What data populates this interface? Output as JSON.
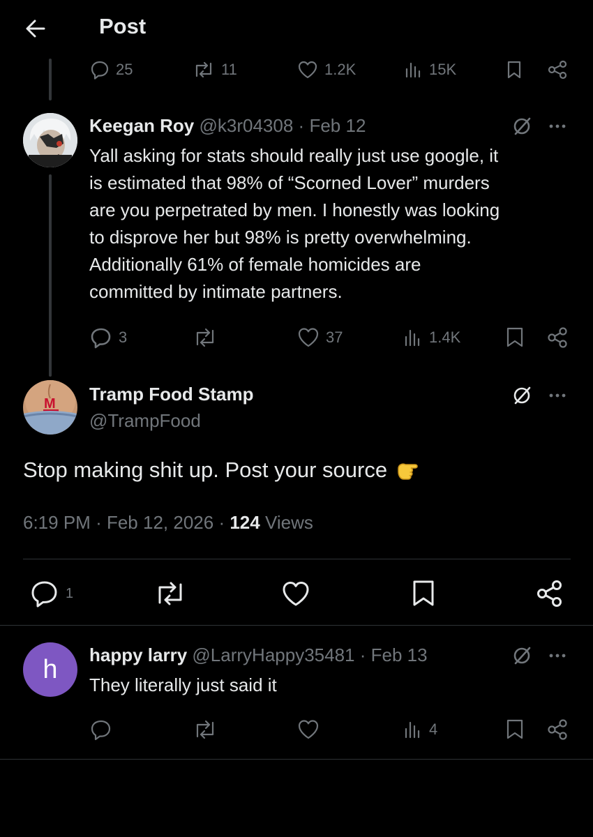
{
  "header": {
    "title": "Post"
  },
  "parent_actions": {
    "replies": "25",
    "reposts": "11",
    "likes": "1.2K",
    "views": "15K"
  },
  "tweet1": {
    "name": "Keegan Roy",
    "handle": "@k3r04308",
    "sep": "·",
    "date": "Feb 12",
    "text": "Yall asking for stats should really just use google, it\nis estimated that 98% of “Scorned Lover” murders\nare you perpetrated by men. I honestly was looking\nto disprove her but 98% is pretty overwhelming.\nAdditionally 61% of female homicides are\ncommitted by intimate partners.",
    "replies": "3",
    "likes": "37",
    "views": "1.4K"
  },
  "main_tweet": {
    "name": "Tramp Food Stamp",
    "handle": "@TrampFood",
    "text": "Stop making shit up. Post your source",
    "emoji": "👉",
    "time": "6:19 PM",
    "sep": "·",
    "date": "Feb 12, 2026",
    "views_count": "124",
    "views_label": "Views",
    "replies": "1"
  },
  "reply": {
    "avatar_letter": "h",
    "avatar_color": "#7e57c2",
    "name": "happy larry",
    "handle": "@LarryHappy35481",
    "sep": "·",
    "date": "Feb 13",
    "text": "They literally just said it",
    "views": "4"
  },
  "colors": {
    "background": "#000000",
    "text": "#e7e9ea",
    "muted": "#71767b",
    "divider": "#2f3336"
  }
}
